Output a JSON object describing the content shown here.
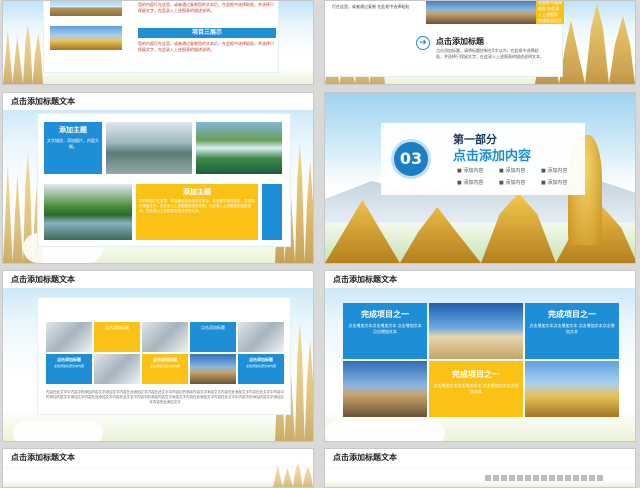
{
  "slide1": {
    "block_a_text": "您的内容打在这里，或者通过复制您的文本后，在此框中选择粘贴，并选择只保留文字，在此录入上述图表的描述说明。",
    "block_b_title": "项目三展示",
    "block_b_text": "您的内容打在这里，或者通过复制您的文本后，在此框中选择粘贴，并选择只保留文字，在此录入上述图表的描述说明。"
  },
  "slide2": {
    "left_text": "打在这里，或者通过复制 在此框中选择粘贴",
    "title": "点击添加标题",
    "text": "点击添加标题，请将标题控制在5字以内，在此框中选择粘贴，并选择只保留文字，在此录入上述图表的描述说明文本。",
    "yellow_text": "在此框中选择粘贴 在此录入上述图表 的描述说明文本"
  },
  "slide3": {
    "bar_title": "点击添加标题文本",
    "blue_title": "添加主题",
    "blue_text": "文字描述，添加图片，内容大概。",
    "yellow_title": "添加主题",
    "yellow_text": "您的内容打在这里，或者通过复制您的文本后，在此框中选择粘贴，并选择只保留文字，在此录入上述图表的描述说明。在此录入上述图表的描述说明，在此录入上述图表的描述说明文本。"
  },
  "slide4": {
    "number": "03",
    "part": "第一部分",
    "heading": "点击添加内容",
    "bullets": [
      "添加内容",
      "添加内容",
      "添加内容",
      "添加内容",
      "添加内容",
      "添加内容"
    ]
  },
  "slide5": {
    "bar_title": "点击添加标题文本",
    "cell_label": "点击添加标题",
    "cell_text": "点击添加标题文本内容",
    "cell_labels": [
      "点击添加标题",
      "点击添加标题",
      "点击添加标题",
      "点击添加标题"
    ],
    "cell_texts": [
      "点击添加标题文本内容",
      "点击添加标题文本内容",
      "点击添加标题文本内容",
      "点击添加标题文本内容"
    ],
    "body_text": "内容在此文字中内容中的添加内容文字添加文字内容在此添加文字内容在此文字中内容中的添加内容文字添加文字内容在此添加文字内容在此文字中内容中的添加内容文字添加文字内容在此添加文字内容在此文字中内容中的添加内容文字添加文字内容在此添加文字内容在此文字中内容中的添加内容文字添加文字内容在此添加文字"
  },
  "slide6": {
    "bar_title": "点击添加标题文本",
    "box1_title": "完成项目之一",
    "box1_text": "点击增加文本点击增加文本 点击增加文本点击增加文本",
    "box2_title": "完成项目之一",
    "box2_text": "点击增加文本点击增加文本 点击增加文本点击增加文本",
    "box3_title": "完成项目之一",
    "box3_text": "点击增加文本点击增加文本 点击增加文本点击增加文本"
  },
  "slide7": {
    "bar_title": "点击添加标题文本"
  },
  "slide8": {
    "bar_title": "点击添加标题文本"
  },
  "colors": {
    "blue": "#1e8fd6",
    "yellow": "#fbc216",
    "number_circle": "#1a7fc4"
  }
}
